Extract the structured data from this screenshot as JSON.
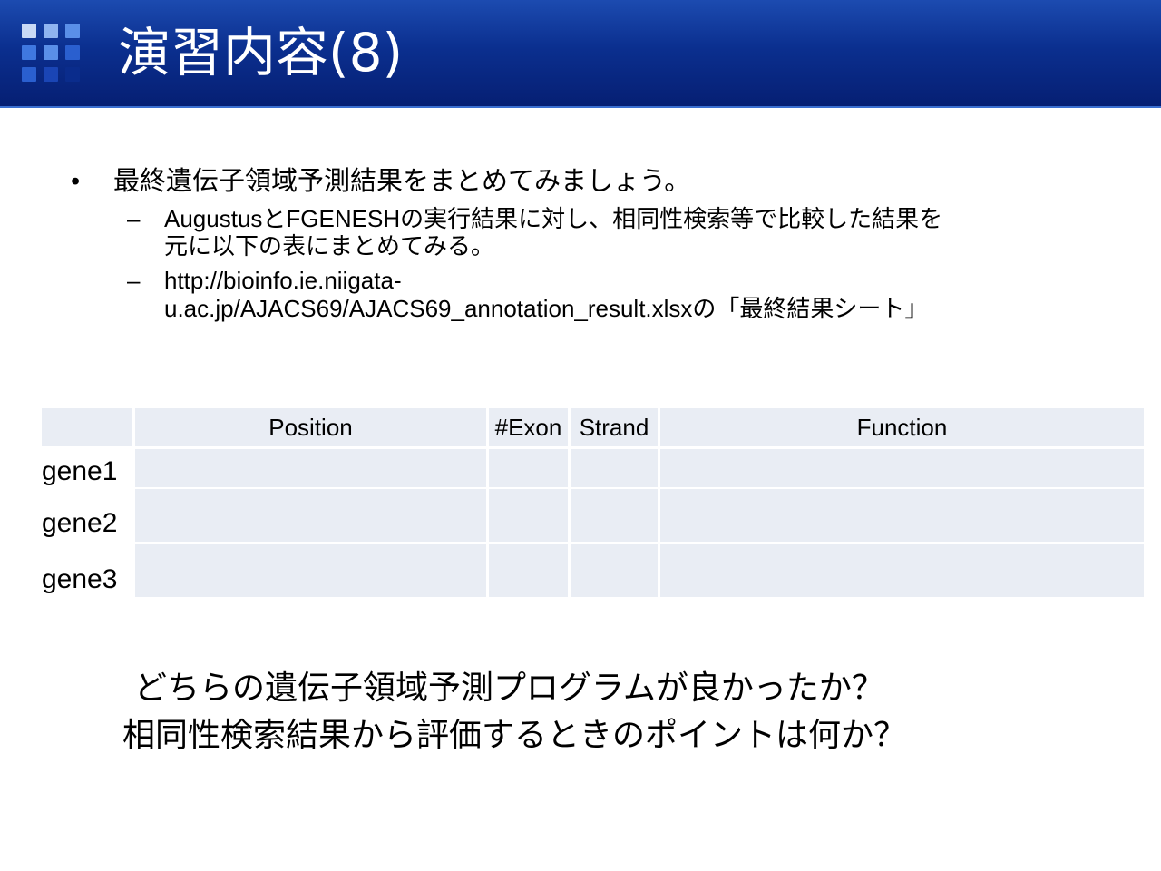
{
  "slide": {
    "title": "演習内容(8)"
  },
  "bullets": {
    "main_mark": "•",
    "main_text": "最終遺伝子領域予測結果をまとめてみましょう。",
    "sub_mark": "–",
    "sub1_line1": "AugustusとFGENESHの実行結果に対し、相同性検索等で比較した結果を",
    "sub1_line2": "元に以下の表にまとめてみる。",
    "sub2_line1": "http://bioinfo.ie.niigata-",
    "sub2_line2": "u.ac.jp/AJACS69/AJACS69_annotation_result.xlsxの「最終結果シート」"
  },
  "table": {
    "headers": [
      "",
      "Position",
      "#Exon",
      "Strand",
      "Function"
    ],
    "rows": [
      {
        "label": "gene1",
        "cells": [
          "",
          "",
          "",
          ""
        ]
      },
      {
        "label": "gene2",
        "cells": [
          "",
          "",
          "",
          ""
        ]
      },
      {
        "label": "gene3",
        "cells": [
          "",
          "",
          "",
          ""
        ]
      }
    ]
  },
  "questions": {
    "q1": "どちらの遺伝子領域予測プログラムが良かったか？",
    "q2": "相同性検索結果から評価するときのポイントは何か？"
  },
  "colors": {
    "header_dark": "#061f73",
    "header_light": "#1c4bb0",
    "table_cell": "#e9edf4",
    "logo_light": "#8fb4f0",
    "logo_mid": "#3f78e0",
    "logo_dark": "#0a2c8c"
  }
}
